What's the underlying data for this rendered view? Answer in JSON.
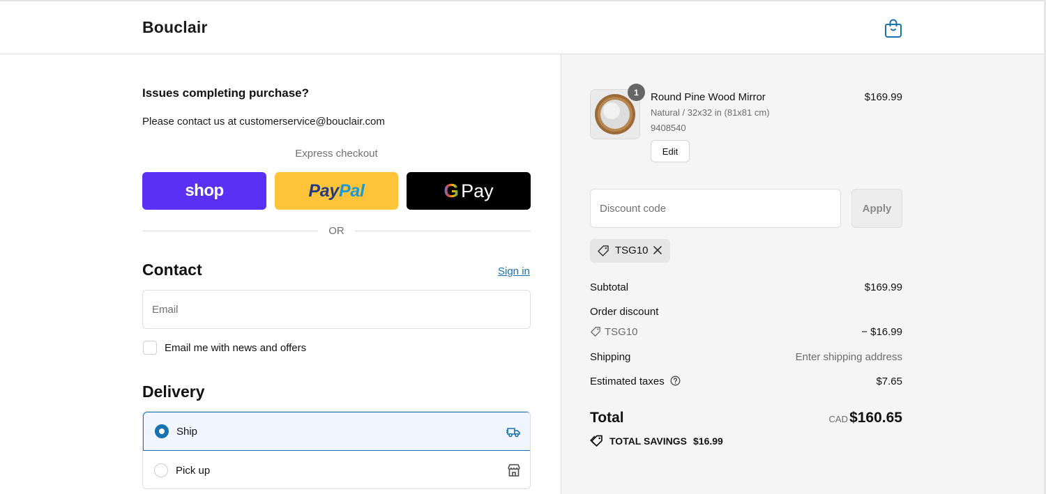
{
  "header": {
    "brand": "Bouclair",
    "cart_icon": "shopping-bag-icon"
  },
  "support": {
    "title": "Issues completing purchase?",
    "text": "Please contact us at customerservice@bouclair.com"
  },
  "express": {
    "label": "Express checkout",
    "shop_label": "shop",
    "paypal_label_a": "Pay",
    "paypal_label_b": "Pal",
    "gpay_g": "G",
    "gpay_label": "Pay",
    "or_label": "OR"
  },
  "contact": {
    "title": "Contact",
    "sign_in": "Sign in",
    "email_placeholder": "Email",
    "email_value": "",
    "newsletter_label": "Email me with news and offers",
    "newsletter_checked": false
  },
  "delivery": {
    "title": "Delivery",
    "options": [
      {
        "label": "Ship",
        "selected": true,
        "icon": "delivery-truck-icon"
      },
      {
        "label": "Pick up",
        "selected": false,
        "icon": "store-icon"
      }
    ]
  },
  "order": {
    "item": {
      "quantity": "1",
      "name": "Round Pine Wood Mirror",
      "variant": "Natural / 32x32 in (81x81 cm)",
      "sku": "9408540",
      "price": "$169.99",
      "edit_label": "Edit"
    },
    "discount": {
      "placeholder": "Discount code",
      "value": "",
      "apply_label": "Apply",
      "applied_code": "TSG10"
    },
    "summary": {
      "subtotal_label": "Subtotal",
      "subtotal_value": "$169.99",
      "order_discount_label": "Order discount",
      "discount_code": "TSG10",
      "discount_value": "− $16.99",
      "shipping_label": "Shipping",
      "shipping_value": "Enter shipping address",
      "taxes_label": "Estimated taxes",
      "taxes_value": "$7.65",
      "total_label": "Total",
      "currency": "CAD",
      "total_value": "$160.65",
      "savings_label": "TOTAL SAVINGS",
      "savings_value": "$16.99"
    }
  },
  "colors": {
    "accent": "#1773b0",
    "shop_pay": "#5a31f4",
    "paypal": "#ffc439",
    "gpay": "#000000",
    "summary_bg": "#f5f5f5"
  }
}
